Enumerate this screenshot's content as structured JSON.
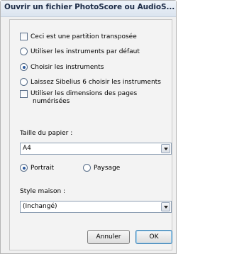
{
  "window": {
    "title": "Ouvrir un fichier PhotoScore ou AudioS..."
  },
  "options": {
    "transposed_score": {
      "label": "Ceci est une partition transposée",
      "checked": false
    },
    "instrument_mode": {
      "selected": "choose",
      "items": [
        {
          "key": "default",
          "label": "Utiliser les instruments par défaut"
        },
        {
          "key": "choose",
          "label": "Choisir les instruments"
        },
        {
          "key": "sibelius",
          "label": "Laissez Sibelius 6 choisir les instruments"
        }
      ]
    },
    "scanned_dimensions": {
      "label_line1": "Utiliser les dimensions des pages",
      "label_line2": "numérisées",
      "checked": false
    }
  },
  "paper": {
    "label": "Taille du papier :",
    "selected": "A4",
    "orientation": {
      "selected": "portrait",
      "portrait_label": "Portrait",
      "landscape_label": "Paysage"
    }
  },
  "house_style": {
    "label": "Style maison :",
    "selected": "(Inchangé)"
  },
  "buttons": {
    "cancel": "Annuler",
    "ok": "OK"
  }
}
